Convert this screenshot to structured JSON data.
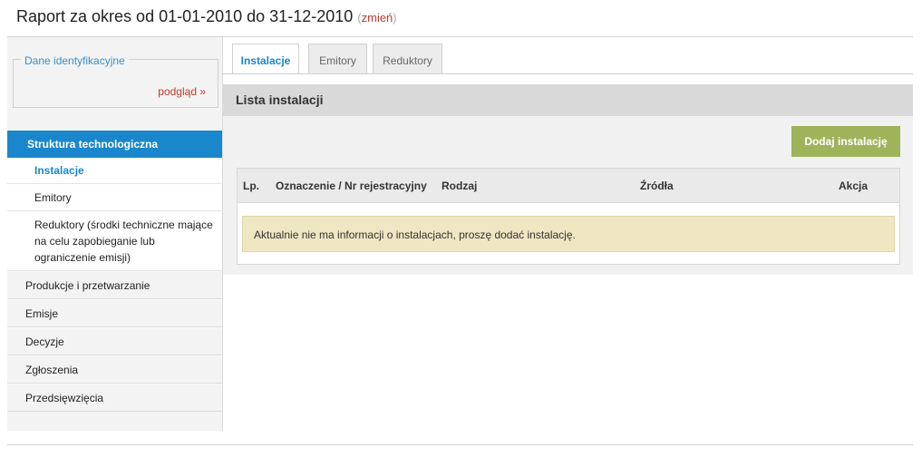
{
  "header": {
    "title": "Raport za okres od 01-01-2010 do 31-12-2010",
    "change_open": "(",
    "change_link": "zmień",
    "change_close": ")"
  },
  "sidebar": {
    "fieldset_legend": "Dane identyfikacyjne",
    "preview_link": "podgląd »",
    "active_section": "Struktura technologiczna",
    "subitems": [
      "Instalacje",
      "Emitory",
      "Reduktory (środki techniczne mające na celu zapobieganie lub ograniczenie emisji)"
    ],
    "items": [
      "Produkcje i przetwarzanie",
      "Emisje",
      "Decyzje",
      "Zgłoszenia",
      "Przedsięwzięcia"
    ]
  },
  "tabs": [
    "Instalacje",
    "Emitory",
    "Reduktory"
  ],
  "main": {
    "panel_title": "Lista instalacji",
    "add_button": "Dodaj instalację",
    "columns": [
      "Lp.",
      "Oznaczenie / Nr rejestracyjny",
      "Rodzaj",
      "Źródła",
      "Akcja"
    ],
    "empty_notice": "Aktualnie nie ma informacji o instalacjach, proszę dodać instalację."
  },
  "colors": {
    "accent_blue": "#1a87cc",
    "link_red": "#c0392b",
    "button_green": "#9fb35b",
    "notice_bg": "#efe6c2"
  }
}
